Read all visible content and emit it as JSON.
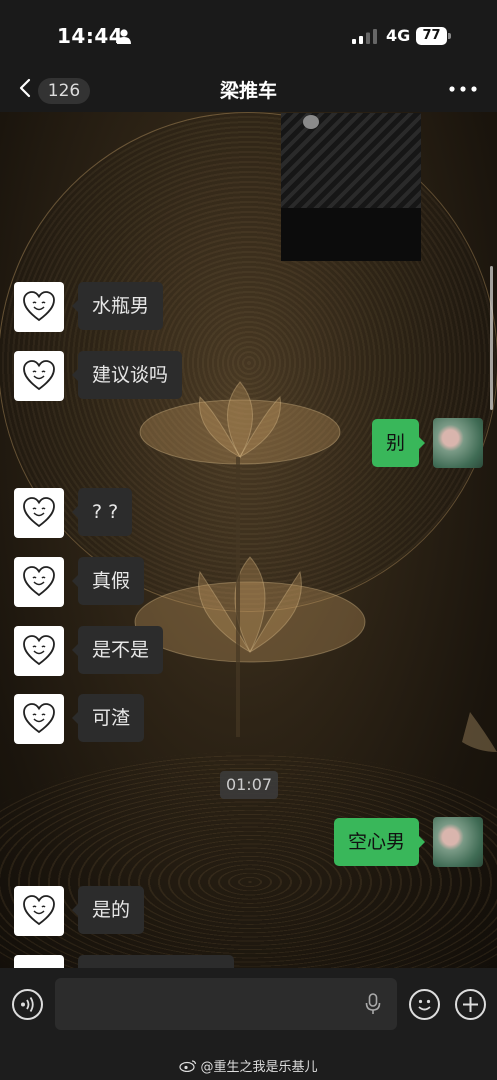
{
  "status_bar": {
    "time": "14:44",
    "network": "4G",
    "battery": "77"
  },
  "header": {
    "back_count": "126",
    "title": "梁推车"
  },
  "messages": [
    {
      "side": "left",
      "text": "水瓶男"
    },
    {
      "side": "left",
      "text": "建议谈吗"
    },
    {
      "side": "right",
      "text": "别"
    },
    {
      "side": "left",
      "text": "? ?"
    },
    {
      "side": "left",
      "text": "真假"
    },
    {
      "side": "left",
      "text": "是不是"
    },
    {
      "side": "left",
      "text": "可渣"
    },
    {
      "side": "right",
      "text": "空心男"
    },
    {
      "side": "left",
      "text": "是的"
    }
  ],
  "timestamp": "01:07",
  "footer": {
    "watermark": "@重生之我是乐基儿"
  },
  "colors": {
    "my_bubble": "#39b75a",
    "their_bubble": "#2c2c2c",
    "bar_bg": "#1a1a1a"
  },
  "icons": [
    "person-icon",
    "signal-icon",
    "battery-icon",
    "back-chevron-icon",
    "more-icon",
    "heart-face-icon",
    "voice-icon",
    "mic-icon",
    "emoji-icon",
    "plus-icon",
    "weibo-icon"
  ]
}
